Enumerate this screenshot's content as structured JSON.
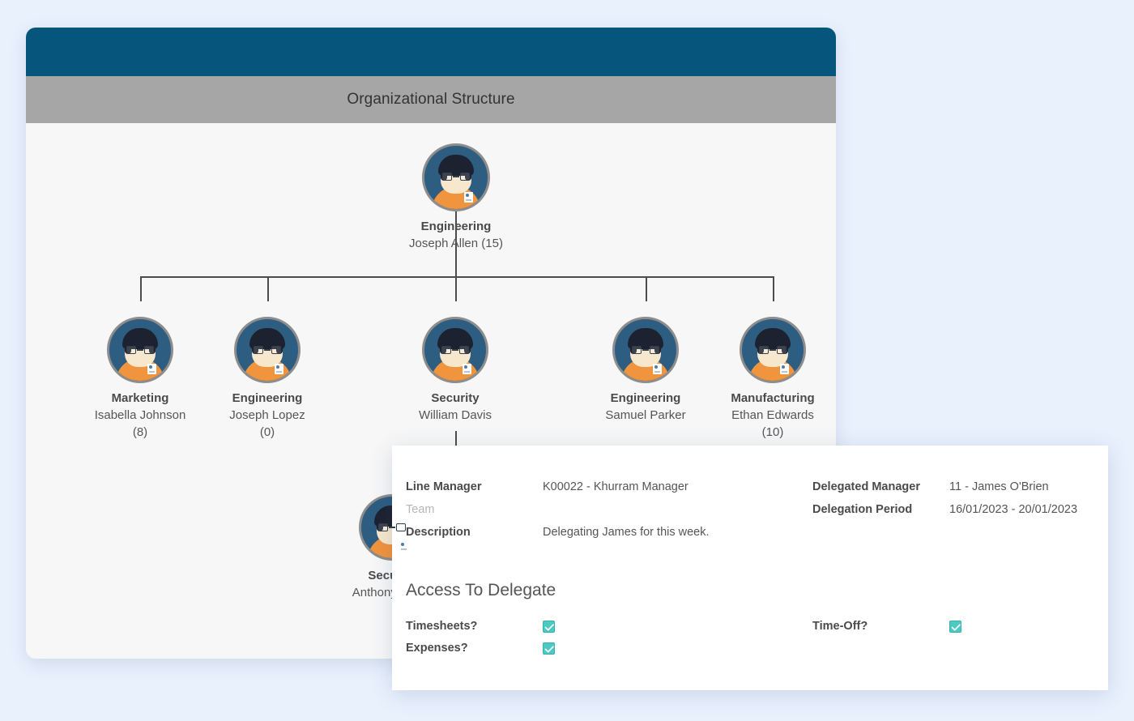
{
  "page": {
    "background_color": "#e9f1fd"
  },
  "org_card": {
    "topbar_color": "#05557d",
    "subbar_color": "#a6a6a6",
    "title": "Organizational Structure",
    "root": {
      "dept": "Engineering",
      "person": "Joseph Allen (15)",
      "count": ""
    },
    "children": [
      {
        "dept": "Marketing",
        "person": "Isabella Johnson",
        "count": "(8)"
      },
      {
        "dept": "Engineering",
        "person": "Joseph Lopez",
        "count": "(0)"
      },
      {
        "dept": "Security",
        "person": "William Davis",
        "count": ""
      },
      {
        "dept": "Engineering",
        "person": "Samuel Parker",
        "count": ""
      },
      {
        "dept": "Manufacturing",
        "person": "Ethan Edwards",
        "count": "(10)"
      }
    ],
    "grandchild": {
      "dept": "Security",
      "person": "Anthony Baker",
      "count": ""
    }
  },
  "detail_panel": {
    "fields_left": [
      {
        "label": "Line Manager",
        "value": "K00022 - Khurram Manager",
        "muted": false
      },
      {
        "label": "Team",
        "value": "",
        "muted": true
      },
      {
        "label": "Description",
        "value": "Delegating James for this week.",
        "muted": false
      }
    ],
    "fields_right": [
      {
        "label": "Delegated Manager",
        "value": "11 - James O'Brien"
      },
      {
        "label": "Delegation Period",
        "value": "16/01/2023 - 20/01/2023"
      }
    ],
    "section_title": "Access To Delegate",
    "checks_left": [
      {
        "label": "Timesheets?",
        "checked": true
      },
      {
        "label": "Expenses?",
        "checked": true
      }
    ],
    "checks_right": [
      {
        "label": "Time-Off?",
        "checked": true
      }
    ],
    "checkbox_color": "#4ec8c2"
  }
}
